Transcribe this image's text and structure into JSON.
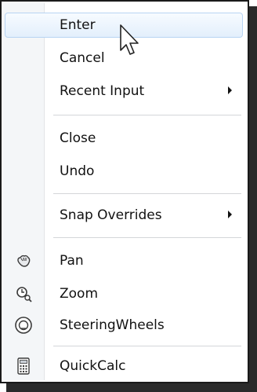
{
  "menu": {
    "items": [
      {
        "label": "Enter"
      },
      {
        "label": "Cancel"
      },
      {
        "label": "Recent Input"
      },
      {
        "label": "Close"
      },
      {
        "label": "Undo"
      },
      {
        "label": "Snap Overrides"
      },
      {
        "label": "Pan",
        "icon": "pan-hand-icon"
      },
      {
        "label": "Zoom",
        "icon": "zoom-magnifier-icon"
      },
      {
        "label": "SteeringWheels",
        "icon": "steering-wheel-icon"
      },
      {
        "label": "QuickCalc",
        "icon": "calculator-icon"
      }
    ]
  },
  "colors": {
    "highlight_border": "#b8d4f2",
    "highlight_fill": "#e3effc",
    "gutter": "#f4f6f8"
  }
}
